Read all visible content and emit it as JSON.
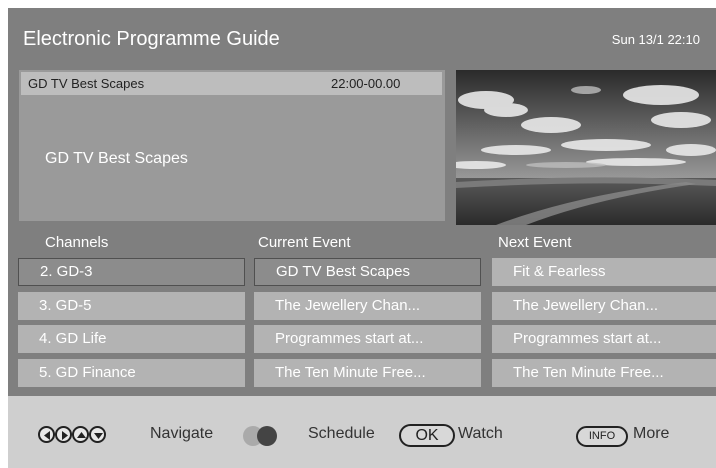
{
  "header": {
    "title": "Electronic Programme Guide",
    "datetime": "Sun 13/1 22:10"
  },
  "event_info": {
    "event_name": "GD TV Best Scapes",
    "time_range": "22:00-00.00",
    "description": "GD TV Best Scapes"
  },
  "preview": {
    "icon": "landscape-preview-image"
  },
  "columns": {
    "channels": "Channels",
    "current": "Current Event",
    "next": "Next Event"
  },
  "rows": [
    {
      "channel": "2. GD-3",
      "current": "GD TV Best Scapes",
      "next": "Fit & Fearless"
    },
    {
      "channel": "3. GD-5",
      "current": "The Jewellery Chan...",
      "next": "The Jewellery Chan..."
    },
    {
      "channel": "4. GD Life",
      "current": "Programmes start at...",
      "next": "Programmes start at..."
    },
    {
      "channel": "5. GD Finance",
      "current": "The Ten Minute Free...",
      "next": "The Ten Minute Free..."
    }
  ],
  "legend": {
    "navigate": "Navigate",
    "schedule": "Schedule",
    "ok_key": "OK",
    "watch": "Watch",
    "info_key": "INFO",
    "more": "More"
  },
  "colors": {
    "background": "#7f7f7f",
    "cell": "#b3b3b3",
    "selected_cell": "#8c8c8c",
    "footer": "#cfcfcf"
  }
}
